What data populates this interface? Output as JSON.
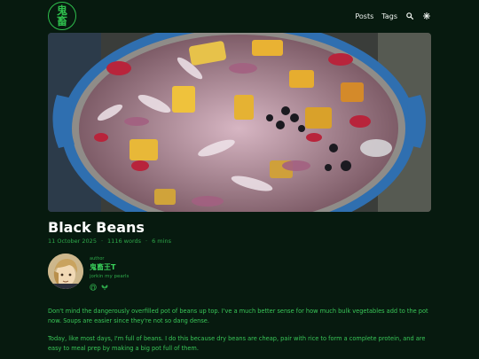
{
  "site": {
    "logo_top": "鬼",
    "logo_bottom": "畜"
  },
  "nav": {
    "posts": "Posts",
    "tags": "Tags",
    "search_icon": "search-icon",
    "theme_icon": "gear-icon"
  },
  "post": {
    "title": "Black Beans",
    "date": "11 October 2025",
    "words": "1116 words",
    "read_time": "6 mins",
    "sep": "·"
  },
  "author": {
    "kicker": "author",
    "name": "鬼畜王T",
    "tagline": "jorkin my pearls",
    "link_icons": [
      "github-icon",
      "bluesky-icon"
    ]
  },
  "body": {
    "p1": "Don't mind the dangerously overfilled pot of beans up top. I've a much better sense for how much bulk vegetables add to the pot now. Soups are easier since they're not so dang dense.",
    "p2": "Today, like most days, I'm full of beans. I do this because dry beans are cheap, pair with rice to form a complete protein, and are easy to meal prep by making a big pot full of them."
  },
  "colors": {
    "background": "#071a0f",
    "accent": "#2fbf4d",
    "text": "#ffffff"
  }
}
